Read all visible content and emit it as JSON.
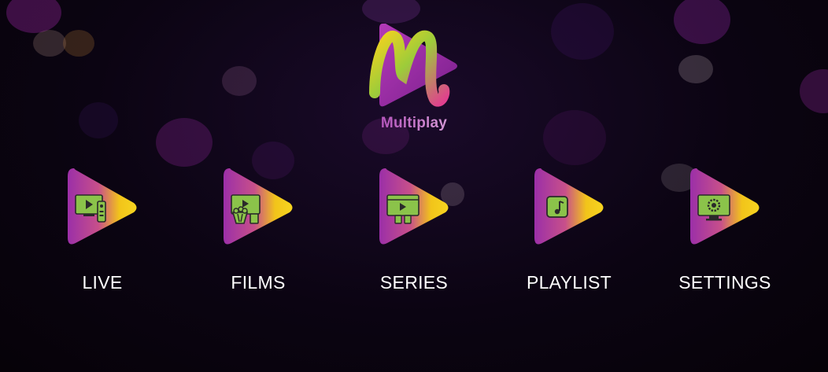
{
  "app": {
    "name": "Multiplay"
  },
  "menu": {
    "items": [
      {
        "label": "LIVE",
        "icon": "tv-remote-icon"
      },
      {
        "label": "FILMS",
        "icon": "film-popcorn-icon"
      },
      {
        "label": "SERIES",
        "icon": "series-monitor-icon"
      },
      {
        "label": "PLAYLIST",
        "icon": "music-note-icon"
      },
      {
        "label": "SETTINGS",
        "icon": "monitor-gear-icon"
      }
    ]
  },
  "colors": {
    "background": "#0b0412",
    "tile_purple": "#9b2fa8",
    "tile_yellow": "#f2c41a",
    "icon_green": "#8bc34a",
    "label": "#ffffff"
  }
}
